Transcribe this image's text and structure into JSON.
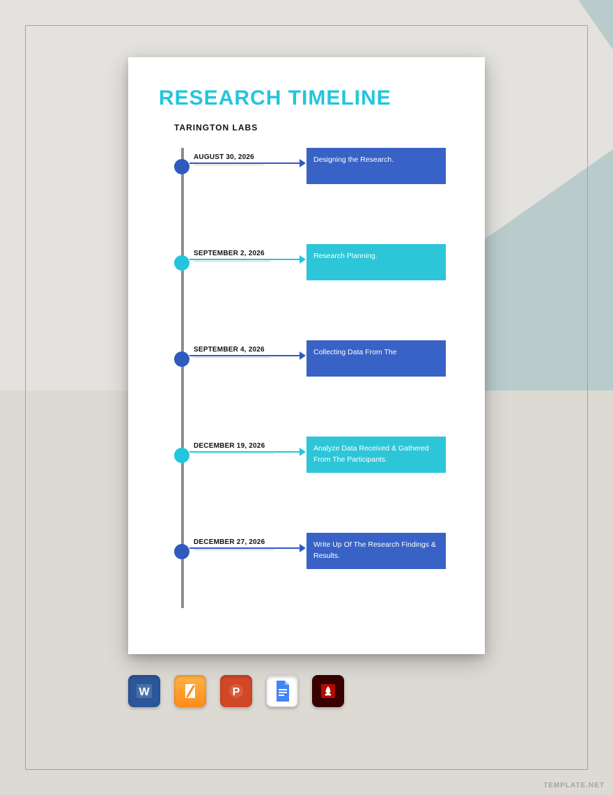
{
  "document": {
    "title": "RESEARCH TIMELINE",
    "subtitle": "TARINGTON LABS"
  },
  "colors": {
    "blue": "#3962c6",
    "teal": "#2cc6d8",
    "title": "#23c5de"
  },
  "timeline": [
    {
      "date": "AUGUST 30, 2026",
      "text": "Designing the Research.",
      "variant": "blue"
    },
    {
      "date": "SEPTEMBER 2, 2026",
      "text": "Research Planning.",
      "variant": "teal"
    },
    {
      "date": "SEPTEMBER 4, 2026",
      "text": "Collecting Data From The",
      "variant": "blue"
    },
    {
      "date": "DECEMBER 19, 2026",
      "text": "Analyze Data Received & Gathered From The Participants.",
      "variant": "teal"
    },
    {
      "date": "DECEMBER 27, 2026",
      "text": "Write Up Of The Research Findings & Results.",
      "variant": "blue"
    }
  ],
  "apps": [
    {
      "name": "word"
    },
    {
      "name": "pages"
    },
    {
      "name": "powerpoint"
    },
    {
      "name": "google-docs"
    },
    {
      "name": "pdf"
    }
  ],
  "watermark": "TEMPLATE.NET"
}
